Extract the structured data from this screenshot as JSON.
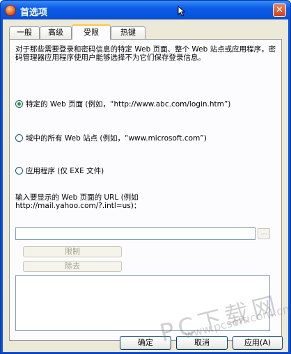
{
  "window": {
    "title": "首选项",
    "close_label": "✕"
  },
  "tabs": [
    {
      "label": "一般",
      "active": false
    },
    {
      "label": "高级",
      "active": false
    },
    {
      "label": "受限",
      "active": true
    },
    {
      "label": "热键",
      "active": false
    }
  ],
  "restrict": {
    "description": "对于那些需要登录和密码信息的特定 Web 页面、整个 Web 站点或应用程序，密码管理器应用程序使用户能够选择不为它们保存登录信息。",
    "options": [
      {
        "label": "特定的 Web 页面 (例如，“http://www.abc.com/login.htm”)",
        "selected": true
      },
      {
        "label": "域中的所有 Web 站点 (例如，“www.microsoft.com”)",
        "selected": false
      },
      {
        "label": "应用程序 (仅 EXE 文件)",
        "selected": false
      }
    ],
    "url_prompt_line1": "输入要显示的 Web 页面的 URL (例如",
    "url_prompt_line2": "http://mail.yahoo.com/?.intl=us)：",
    "url_value": "",
    "browse_label": "...",
    "restrict_button": "限制",
    "remove_button": "除去"
  },
  "footer": {
    "ok_label": "确定",
    "cancel_label": "取消",
    "apply_label": "应用(A)"
  },
  "watermark": {
    "main": "PC下载网",
    "sub": "www.pcsoft.com.cn"
  }
}
